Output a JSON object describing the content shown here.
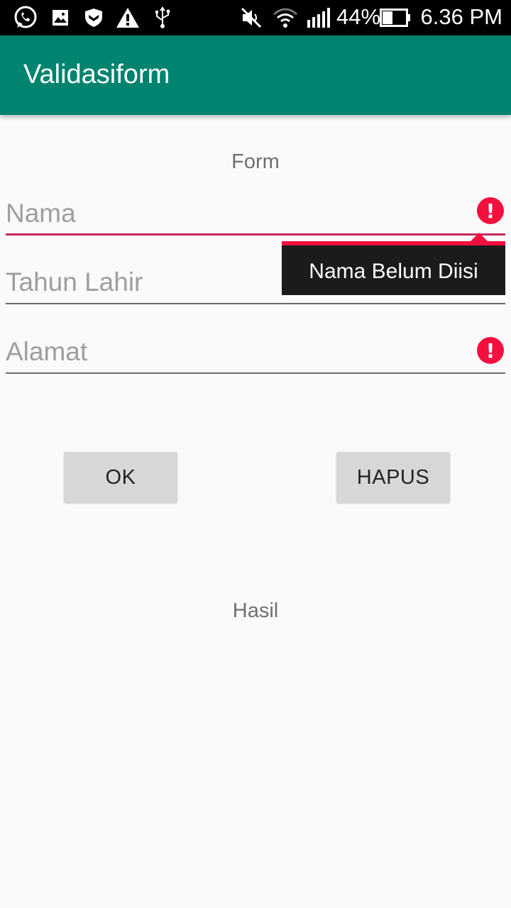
{
  "status_bar": {
    "icons": [
      "whatsapp-icon",
      "image-icon",
      "shield-icon",
      "warning-icon",
      "usb-icon",
      "mute-icon",
      "wifi-icon",
      "signal-icon",
      "battery-icon"
    ],
    "battery_percent": "44%",
    "time": "6.36 PM",
    "battery_level": 0.44
  },
  "app_bar": {
    "title": "Validasiform"
  },
  "form": {
    "heading": "Form",
    "fields": [
      {
        "placeholder": "Nama",
        "value": "",
        "error": true,
        "focused": true
      },
      {
        "placeholder": "Tahun Lahir",
        "value": "",
        "error": true,
        "focused": false
      },
      {
        "placeholder": "Alamat",
        "value": "",
        "error": true,
        "focused": false
      }
    ],
    "error_message": "Nama Belum Diisi",
    "error_icon_glyph": "!"
  },
  "buttons": {
    "ok_label": "OK",
    "clear_label": "HAPUS"
  },
  "result": {
    "label": "Hasil"
  },
  "colors": {
    "app_bar": "#00836f",
    "accent": "#c62a5a",
    "error": "#f2103e",
    "popup_bg": "#1b1b1b",
    "button_bg": "#d7d7d7"
  }
}
